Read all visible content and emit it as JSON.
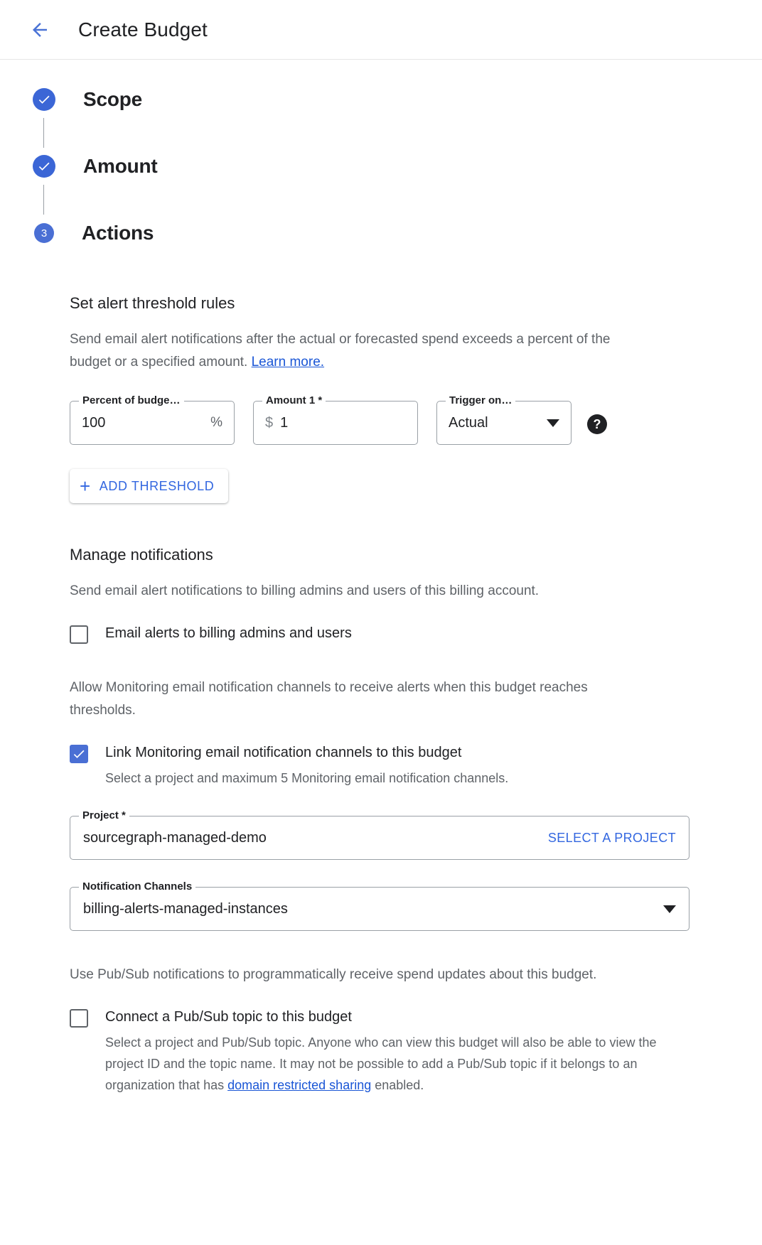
{
  "header": {
    "back_icon": "arrow-left-icon",
    "title": "Create Budget"
  },
  "stepper": {
    "steps": [
      {
        "label": "Scope",
        "state": "complete",
        "marker": "check-icon"
      },
      {
        "label": "Amount",
        "state": "complete",
        "marker": "check-icon"
      },
      {
        "label": "Actions",
        "state": "active",
        "marker": "3"
      }
    ]
  },
  "alert_thresholds": {
    "title": "Set alert threshold rules",
    "description_part1": "Send email alert notifications after the actual or forecasted spend exceeds a percent of the budget or a specified amount. ",
    "learn_more": "Learn more.",
    "fields": {
      "percent": {
        "label": "Percent of budge…",
        "value": "100",
        "suffix": "%"
      },
      "amount": {
        "label": "Amount 1 *",
        "prefix": "$",
        "value": "1"
      },
      "trigger": {
        "label": "Trigger on…",
        "value": "Actual",
        "dropdown_icon": "chevron-down-icon",
        "help_icon": "help-icon",
        "help_glyph": "?"
      }
    },
    "add_threshold_label": "ADD THRESHOLD",
    "add_threshold_icon": "plus-icon"
  },
  "manage_notifications": {
    "title": "Manage notifications",
    "description": "Send email alert notifications to billing admins and users of this billing account.",
    "email_alerts": {
      "label": "Email alerts to billing admins and users",
      "checked": false
    },
    "monitoring_note": "Allow Monitoring email notification channels to receive alerts when this budget reaches thresholds.",
    "link_monitoring": {
      "label": "Link Monitoring email notification channels to this budget",
      "sub": "Select a project and maximum 5 Monitoring email notification channels.",
      "checked": true
    },
    "project_field": {
      "label": "Project *",
      "value": "sourcegraph-managed-demo",
      "action": "SELECT A PROJECT"
    },
    "channels_field": {
      "label": "Notification Channels",
      "value": "billing-alerts-managed-instances",
      "dropdown_icon": "chevron-down-icon"
    },
    "pubsub_note": "Use Pub/Sub notifications to programmatically receive spend updates about this budget.",
    "pubsub": {
      "label": "Connect a Pub/Sub topic to this budget",
      "checked": false,
      "sub_part1": "Select a project and Pub/Sub topic. Anyone who can view this budget will also be able to view the project ID and the topic name. It may not be possible to add a Pub/Sub topic if it belongs to an organization that has ",
      "sub_link": "domain restricted sharing",
      "sub_part2": " enabled."
    }
  },
  "colors": {
    "accent": "#3367e0",
    "step_blue": "#4a6fd4",
    "link": "#1a56d6",
    "text": "#202124",
    "muted": "#5f6368"
  }
}
